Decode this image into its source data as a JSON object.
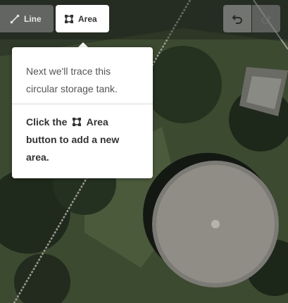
{
  "toolbar": {
    "line_label": "Line",
    "area_label": "Area",
    "undo_icon": "undo-icon",
    "redo_icon": "redo-icon"
  },
  "tooltip": {
    "body_text": "Next we'll trace this circular storage tank.",
    "instruction_before": "Click the",
    "instruction_area": "Area",
    "instruction_after": "button to add a new area."
  },
  "colors": {
    "tooltip_bg": "#ffffff",
    "toolbar_active_bg": "#ffffff",
    "toolbar_inactive_bg": "#787878"
  }
}
